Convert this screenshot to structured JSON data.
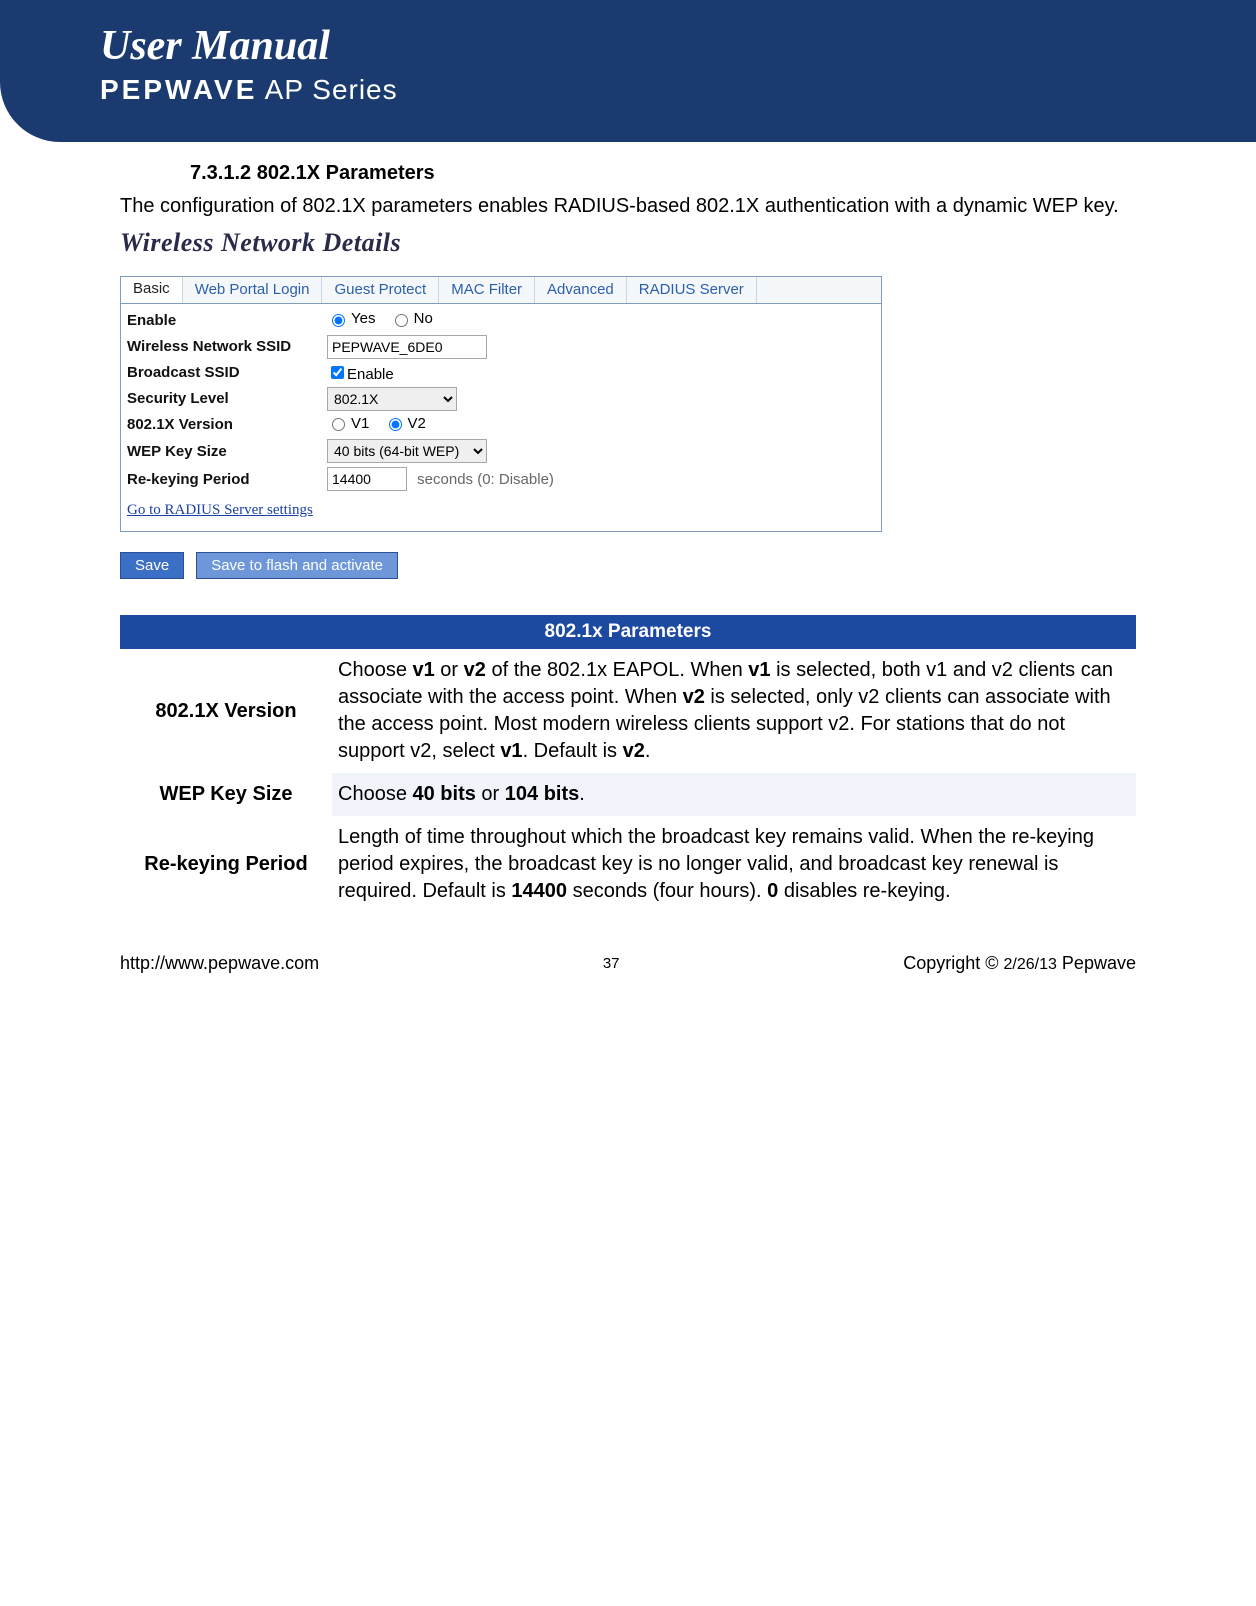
{
  "header": {
    "title": "User Manual",
    "brand": "PEPWAVE",
    "series": "AP Series"
  },
  "section": {
    "number": "7.3.1.2 802.1X Parameters",
    "intro": "The configuration of 802.1X parameters enables RADIUS-based 802.1X authentication with a dynamic WEP key."
  },
  "screenshot": {
    "title": "Wireless Network Details",
    "tabs": [
      "Basic",
      "Web Portal Login",
      "Guest Protect",
      "MAC Filter",
      "Advanced",
      "RADIUS Server"
    ],
    "active_tab": 0,
    "rows": {
      "enable_label": "Enable",
      "enable_yes": "Yes",
      "enable_no": "No",
      "ssid_label": "Wireless Network SSID",
      "ssid_value": "PEPWAVE_6DE0",
      "broadcast_label": "Broadcast SSID",
      "broadcast_enable": "Enable",
      "security_label": "Security Level",
      "security_value": "802.1X",
      "version_label": "802.1X Version",
      "version_v1": "V1",
      "version_v2": "V2",
      "wep_label": "WEP Key Size",
      "wep_value": "40 bits (64-bit WEP)",
      "rekey_label": "Re-keying Period",
      "rekey_value": "14400",
      "rekey_suffix": "seconds (0: Disable)"
    },
    "link": "Go to RADIUS Server settings",
    "save_btn": "Save",
    "save_flash_btn": "Save to flash and activate"
  },
  "param_table": {
    "header": "802.1x Parameters",
    "rows": [
      {
        "label": "802.1X Version",
        "desc_parts": [
          "Choose ",
          "v1",
          " or ",
          "v2",
          " of the 802.1x EAPOL. When ",
          "v1",
          " is selected, both v1 and v2 clients can associate with the access point. When ",
          "v2",
          " is selected, only v2 clients can associate with the access point. Most modern wireless clients support v2.  For stations that do not support v2, select ",
          "v1",
          ". Default is ",
          "v2",
          "."
        ]
      },
      {
        "label": "WEP Key Size",
        "desc_parts": [
          "Choose ",
          "40 bits",
          " or ",
          "104 bits",
          "."
        ]
      },
      {
        "label": "Re-keying Period",
        "desc_parts": [
          "Length of time throughout which the broadcast key remains valid. When the re-keying period expires, the broadcast key is no longer valid, and broadcast key renewal is required. Default is ",
          "14400",
          " seconds (four hours). ",
          "0",
          " disables re-keying."
        ]
      }
    ]
  },
  "footer": {
    "left": "http://www.pepwave.com",
    "center": "37",
    "right_prefix": "Copyright © ",
    "right_date": "2/26/13",
    "right_brand": " Pepwave"
  }
}
